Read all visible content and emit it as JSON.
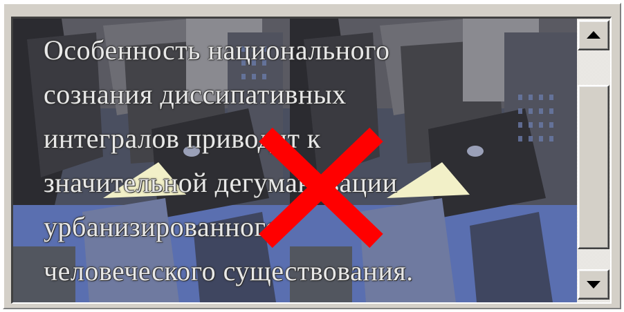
{
  "textarea": {
    "lines": [
      "Особенность национального",
      "сознания диссипативных",
      "интегралов приводит к",
      "значительной дегуманизации",
      "урбанизированного",
      "человеческого существования."
    ],
    "text_color": "#e8e8e8",
    "background_image": "city-skyline-background"
  },
  "scrollbar": {
    "up_icon": "arrow-up-icon",
    "down_icon": "arrow-down-icon"
  },
  "overlay": {
    "icon": "broken-image-x-icon",
    "color": "#ff0000"
  }
}
